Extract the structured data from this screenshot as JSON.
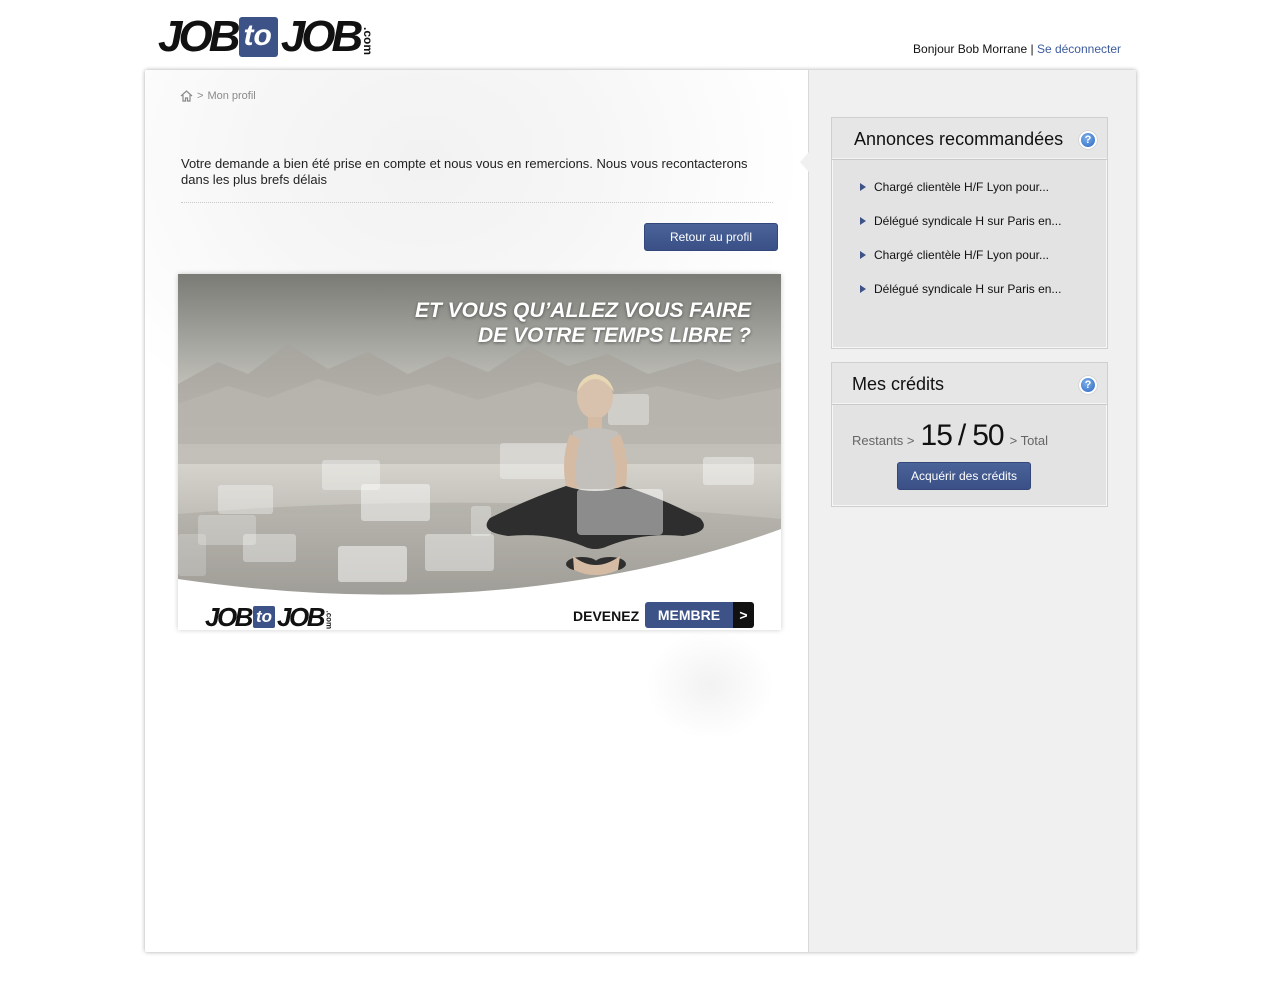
{
  "header": {
    "logo": {
      "job1": "JOB",
      "to": "to",
      "job2": "JOB",
      "com": ".com"
    },
    "greeting": "Bonjour Bob Morrane",
    "separator": "|",
    "logout_label": "Se déconnecter"
  },
  "breadcrumb": {
    "separator": ">",
    "current": "Mon profil"
  },
  "confirmation_message": "Votre demande a bien été prise en compte et nous vous en remercions. Nous vous recontacterons dans les plus brefs délais",
  "retour_button_label": "Retour au profil",
  "banner": {
    "headline_line1": "ET VOUS QU’ALLEZ VOUS FAIRE",
    "headline_line2": "DE VOTRE TEMPS LIBRE ?",
    "logo": {
      "job1": "JOB",
      "to": "to",
      "job2": "JOB",
      "com": ".com"
    },
    "devenez": "DEVENEZ",
    "membre": "MEMBRE",
    "arrow": ">"
  },
  "annonces": {
    "title": "Annonces recommandées",
    "help_icon": "?",
    "items": [
      "Chargé clientèle H/F Lyon pour...",
      "Délégué syndicale H sur Paris en...",
      "Chargé clientèle H/F Lyon pour...",
      "Délégué syndicale H sur Paris en..."
    ]
  },
  "credits": {
    "title": "Mes crédits",
    "help_icon": "?",
    "remaining_label": "Restants >",
    "remaining": "15",
    "slash": "/",
    "total": "50",
    "total_label": "> Total",
    "button_label": "Acquérir des crédits"
  },
  "colors": {
    "brand_blue": "#3d5387",
    "link_blue": "#3d5b9c",
    "panel_gray": "#f0f0f0"
  }
}
